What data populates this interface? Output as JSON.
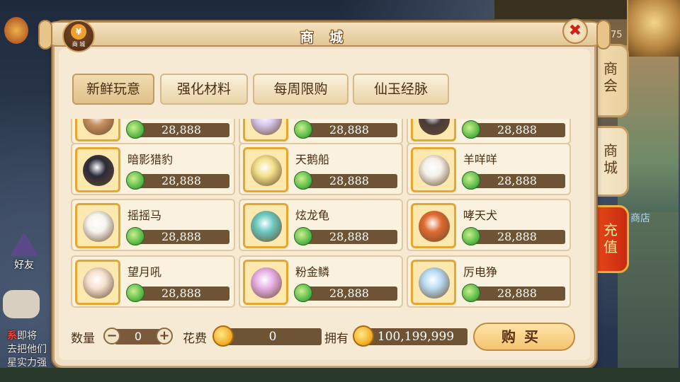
{
  "background": {
    "hero_level": "75",
    "side_labels": {
      "friend": "好友",
      "shop": "商店"
    },
    "chat": [
      {
        "prefix": "系",
        "text": "即将"
      },
      {
        "prefix": "",
        "text": "去把他们"
      },
      {
        "prefix": "",
        "text": "星实力强"
      }
    ]
  },
  "dialog": {
    "title": "商 城",
    "emblem_label": "商 城",
    "emblem_coin": "¥",
    "close_label": "✖"
  },
  "tabs": [
    {
      "label": "新鲜玩意",
      "active": true
    },
    {
      "label": "强化材料",
      "active": false
    },
    {
      "label": "每周限购",
      "active": false
    },
    {
      "label": "仙玉经脉",
      "active": false
    }
  ],
  "side_tabs": [
    {
      "label": "商\n会"
    },
    {
      "label": "商\n城"
    },
    {
      "label": "充\n值"
    }
  ],
  "items": [
    {
      "name": "",
      "price": "28,888",
      "color": "#c89060"
    },
    {
      "name": "",
      "price": "28,888",
      "color": "#d8c8f0"
    },
    {
      "name": "",
      "price": "28,888",
      "color": "#4a3a3a"
    },
    {
      "name": "暗影猎豹",
      "price": "28,888",
      "color": "#2a2a3a"
    },
    {
      "name": "天鹅船",
      "price": "28,888",
      "color": "#f2e08a"
    },
    {
      "name": "羊咩咩",
      "price": "28,888",
      "color": "#f4f0e8"
    },
    {
      "name": "摇摇马",
      "price": "28,888",
      "color": "#f6f4ee"
    },
    {
      "name": "炫龙龟",
      "price": "28,888",
      "color": "#6ac8c0"
    },
    {
      "name": "哮天犬",
      "price": "28,888",
      "color": "#e06a30"
    },
    {
      "name": "望月吼",
      "price": "28,888",
      "color": "#f6e0d0"
    },
    {
      "name": "粉金鳞",
      "price": "28,888",
      "color": "#e8b0e8"
    },
    {
      "name": "厉电狰",
      "price": "28,888",
      "color": "#b8dcf4"
    }
  ],
  "footer": {
    "qty_label": "数量",
    "qty_value": "0",
    "minus": "−",
    "plus": "+",
    "cost_label": "花费",
    "cost_value": "0",
    "own_label": "拥有",
    "own_value": "100,199,999",
    "buy_label": "购买"
  }
}
